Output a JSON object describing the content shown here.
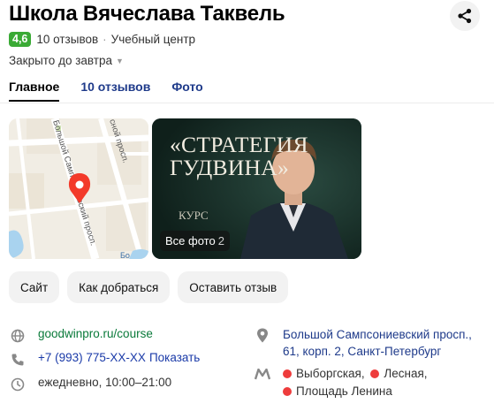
{
  "org": {
    "name": "Школа Вячеслава Таквель",
    "rating": "4,6",
    "reviews_count": "10 отзывов",
    "category": "Учебный центр",
    "hours_status": "Закрыто до завтра"
  },
  "tabs": [
    {
      "label": "Главное",
      "active": true
    },
    {
      "label": "10 отзывов",
      "active": false
    },
    {
      "label": "Фото",
      "active": false
    }
  ],
  "map": {
    "street_label_1": "Большой Сампсониевский просп.",
    "street_label_2": "сной просп.",
    "street_label_3": "Бо"
  },
  "photo": {
    "title_line1": "«СТРАТЕГИЯ",
    "title_line2": "ГУДВИНА»",
    "course_label": "КУРС",
    "all_photos_label": "Все фото",
    "all_photos_count": "2"
  },
  "actions": {
    "site": "Сайт",
    "route": "Как добраться",
    "review": "Оставить отзыв"
  },
  "contacts": {
    "website": "goodwinpro.ru/course",
    "phone": "+7 (993) 775-XX-XX",
    "phone_action": "Показать",
    "hours": "ежедневно, 10:00–21:00",
    "address_line1": "Большой Сампсониевский просп.,",
    "address_line2": "61, корп. 2, Санкт-Петербург",
    "metro_1": "Выборгская,",
    "metro_2": "Лесная,",
    "metro_3": "Площадь Ленина"
  },
  "colors": {
    "rating_badge": "#3aaa35",
    "link_green": "#0a7a3a",
    "link_blue": "#1e3a8a",
    "metro_dot": "#ee3c3c",
    "map_pin": "#f33a2a"
  },
  "icons": [
    "share-icon",
    "globe-icon",
    "phone-icon",
    "clock-icon",
    "location-pin-icon",
    "metro-icon",
    "map-pin-icon"
  ]
}
